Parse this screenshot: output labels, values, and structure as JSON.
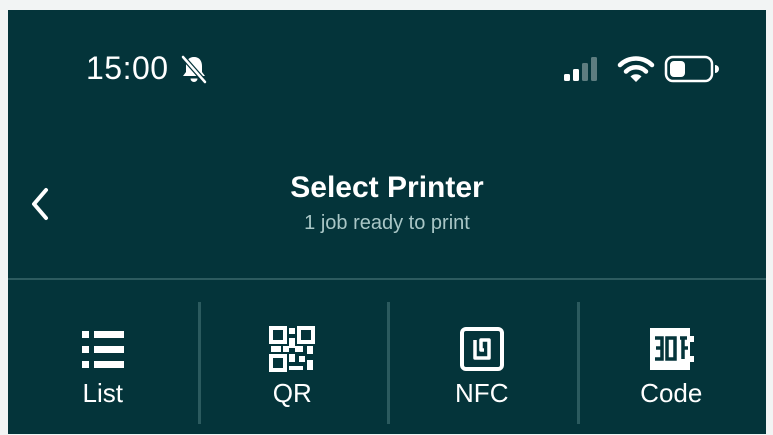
{
  "status_bar": {
    "time": "15:00",
    "icons": [
      "bell-slash-icon",
      "cellular-signal-icon",
      "wifi-icon",
      "battery-icon"
    ]
  },
  "header": {
    "title": "Select Printer",
    "subtitle": "1 job ready to print",
    "back_icon": "chevron-left-icon"
  },
  "tabs": [
    {
      "label": "List",
      "icon": "list-icon"
    },
    {
      "label": "QR",
      "icon": "qr-code-icon"
    },
    {
      "label": "NFC",
      "icon": "nfc-icon"
    },
    {
      "label": "Code",
      "icon": "code-icon"
    }
  ],
  "colors": {
    "background": "#04343a",
    "text": "#ffffff",
    "subtitle": "#a9c6c6",
    "separator": "#2b5a5e"
  }
}
